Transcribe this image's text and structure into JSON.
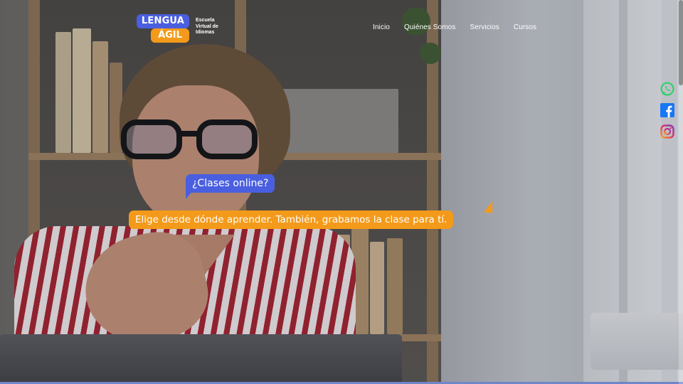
{
  "brand": {
    "logo_top": "LENGUA",
    "logo_bottom": "ÁGIL",
    "tagline_1": "Escuela",
    "tagline_2": "Virtual de",
    "tagline_3": "Idiomas",
    "colors": {
      "blue": "#4a5fe0",
      "orange": "#f49a1a"
    }
  },
  "nav": {
    "items": [
      {
        "label": "Inicio"
      },
      {
        "label": "Quiénes Somos"
      },
      {
        "label": "Servicios"
      },
      {
        "label": "Cursos"
      }
    ]
  },
  "hero": {
    "question": "¿Clases online?",
    "answer": "Elige desde dónde aprender. También, grabamos la clase para tí."
  },
  "social": {
    "icons": [
      "whatsapp-icon",
      "facebook-icon",
      "instagram-icon"
    ]
  }
}
